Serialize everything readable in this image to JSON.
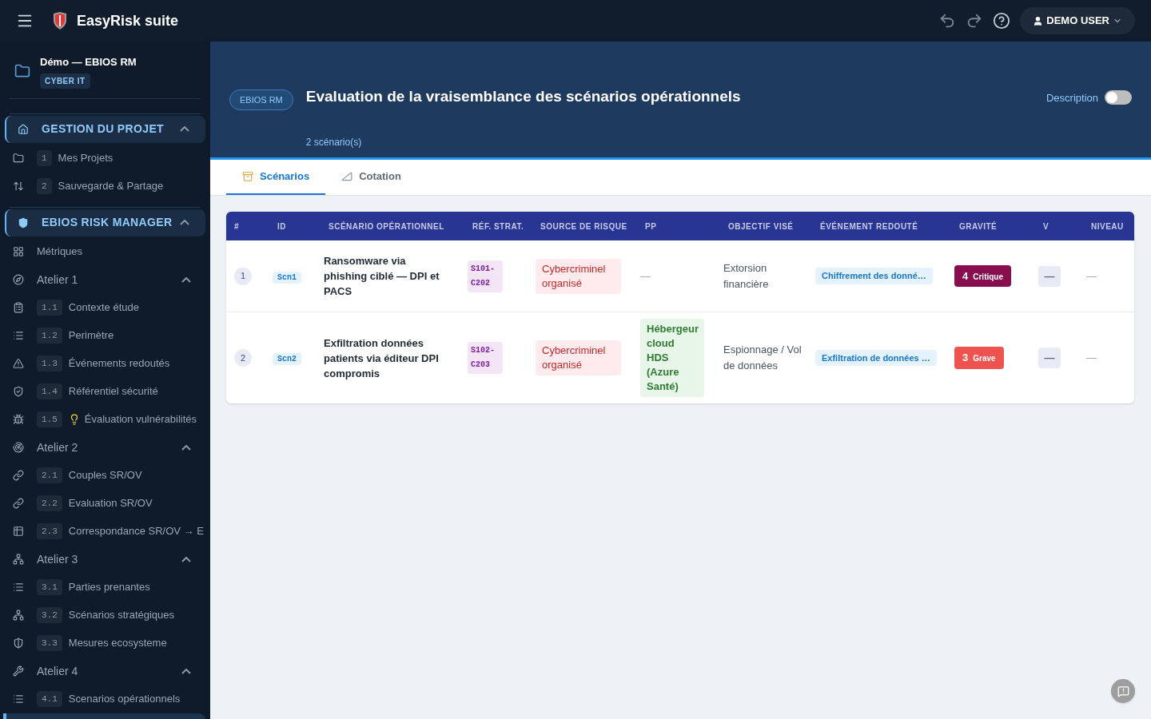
{
  "topbar": {
    "app_title": "EasyRisk suite",
    "user": "DEMO USER"
  },
  "sidebar": {
    "project": {
      "title": "Démo — EBIOS RM",
      "tag": "CYBER IT"
    },
    "sections": [
      {
        "label": "GESTION DU PROJET",
        "expanded": true,
        "children": [
          {
            "kind": "page",
            "number": "1",
            "label": "Mes Projets",
            "tip": false,
            "selected": false
          },
          {
            "kind": "page",
            "number": "2",
            "label": "Sauvegarde & Partage",
            "tip": false,
            "selected": false
          }
        ]
      },
      {
        "label": "EBIOS RISK MANAGER",
        "expanded": true,
        "children": [
          {
            "kind": "link",
            "label": "Métriques",
            "selected": false
          },
          {
            "kind": "group",
            "label": "Atelier 1",
            "expanded": true,
            "children": [
              {
                "kind": "page",
                "number": "1.1",
                "label": "Contexte étude",
                "tip": false,
                "selected": false
              },
              {
                "kind": "page",
                "number": "1.2",
                "label": "Perimètre",
                "tip": false,
                "selected": false
              },
              {
                "kind": "page",
                "number": "1.3",
                "label": "Événements redoutés",
                "tip": false,
                "selected": false
              },
              {
                "kind": "page",
                "number": "1.4",
                "label": "Référentiel sécurité",
                "tip": false,
                "selected": false
              },
              {
                "kind": "page",
                "number": "1.5",
                "label": "Évaluation vulnérabilités",
                "tip": true,
                "selected": false
              }
            ]
          },
          {
            "kind": "group",
            "label": "Atelier 2",
            "expanded": true,
            "children": [
              {
                "kind": "page",
                "number": "2.1",
                "label": "Couples SR/OV",
                "tip": false,
                "selected": false
              },
              {
                "kind": "page",
                "number": "2.2",
                "label": "Evaluation SR/OV",
                "tip": false,
                "selected": false
              },
              {
                "kind": "page",
                "number": "2.3",
                "label": "Correspondance SR/OV → E",
                "tip": false,
                "selected": false
              }
            ]
          },
          {
            "kind": "group",
            "label": "Atelier 3",
            "expanded": true,
            "children": [
              {
                "kind": "page",
                "number": "3.1",
                "label": "Parties prenantes",
                "tip": false,
                "selected": false
              },
              {
                "kind": "page",
                "number": "3.2",
                "label": "Scénarios stratégiques",
                "tip": false,
                "selected": false
              },
              {
                "kind": "page",
                "number": "3.3",
                "label": "Mesures ecosysteme",
                "tip": false,
                "selected": false
              }
            ]
          },
          {
            "kind": "group",
            "label": "Atelier 4",
            "expanded": true,
            "children": [
              {
                "kind": "page",
                "number": "4.1",
                "label": "Scenarios opérationnels",
                "tip": false,
                "selected": false
              },
              {
                "kind": "page",
                "tip": false,
                "selected": true
              }
            ]
          }
        ]
      }
    ]
  },
  "page_header": {
    "badge": "EBIOS RM",
    "title": "Evaluation de la vraisemblance des scénarios opérationnels",
    "count": "2 scénario(s)",
    "description_toggle": {
      "label": "Description",
      "on": false
    }
  },
  "tabs": [
    {
      "kind": "scenarios",
      "label": "Scénarios",
      "selected": true
    },
    {
      "kind": "cotation",
      "label": "Cotation",
      "selected": false
    }
  ],
  "table": {
    "columns": [
      "#",
      "ID",
      "SCÉNARIO OPÉRATIONNEL",
      "RÉF. STRAT.",
      "SOURCE DE RISQUE",
      "PP",
      "OBJECTIF VISÉ",
      "ÉVÉNEMENT REDOUTÉ",
      "GRAVITÉ",
      "V",
      "NIVEAU"
    ],
    "rows": [
      {
        "index": "1",
        "id": "Scn1",
        "scenario": "Ransomware via phishing ciblé — DPI et PACS",
        "ref": "S101-C202",
        "source": "Cybercriminel organisé",
        "pp": {
          "kind": "empty",
          "text": "—"
        },
        "objective": "Extorsion financière",
        "event": "Chiffrement des donné…",
        "gravity": {
          "value": "4",
          "label": "Critique",
          "color": "#880e4f"
        },
        "v": "—",
        "level": "—"
      },
      {
        "index": "2",
        "id": "Scn2",
        "scenario": "Exfiltration données patients via éditeur DPI compromis",
        "ref": "S102-C203",
        "source": "Cybercriminel organisé",
        "pp": {
          "kind": "chip",
          "text": "Hébergeur cloud HDS (Azure Santé)"
        },
        "objective": "Espionnage / Vol de données",
        "event": "Exfiltration de données …",
        "gravity": {
          "value": "3",
          "label": "Grave",
          "color": "#ef5350"
        },
        "v": "—",
        "level": "—"
      }
    ]
  }
}
